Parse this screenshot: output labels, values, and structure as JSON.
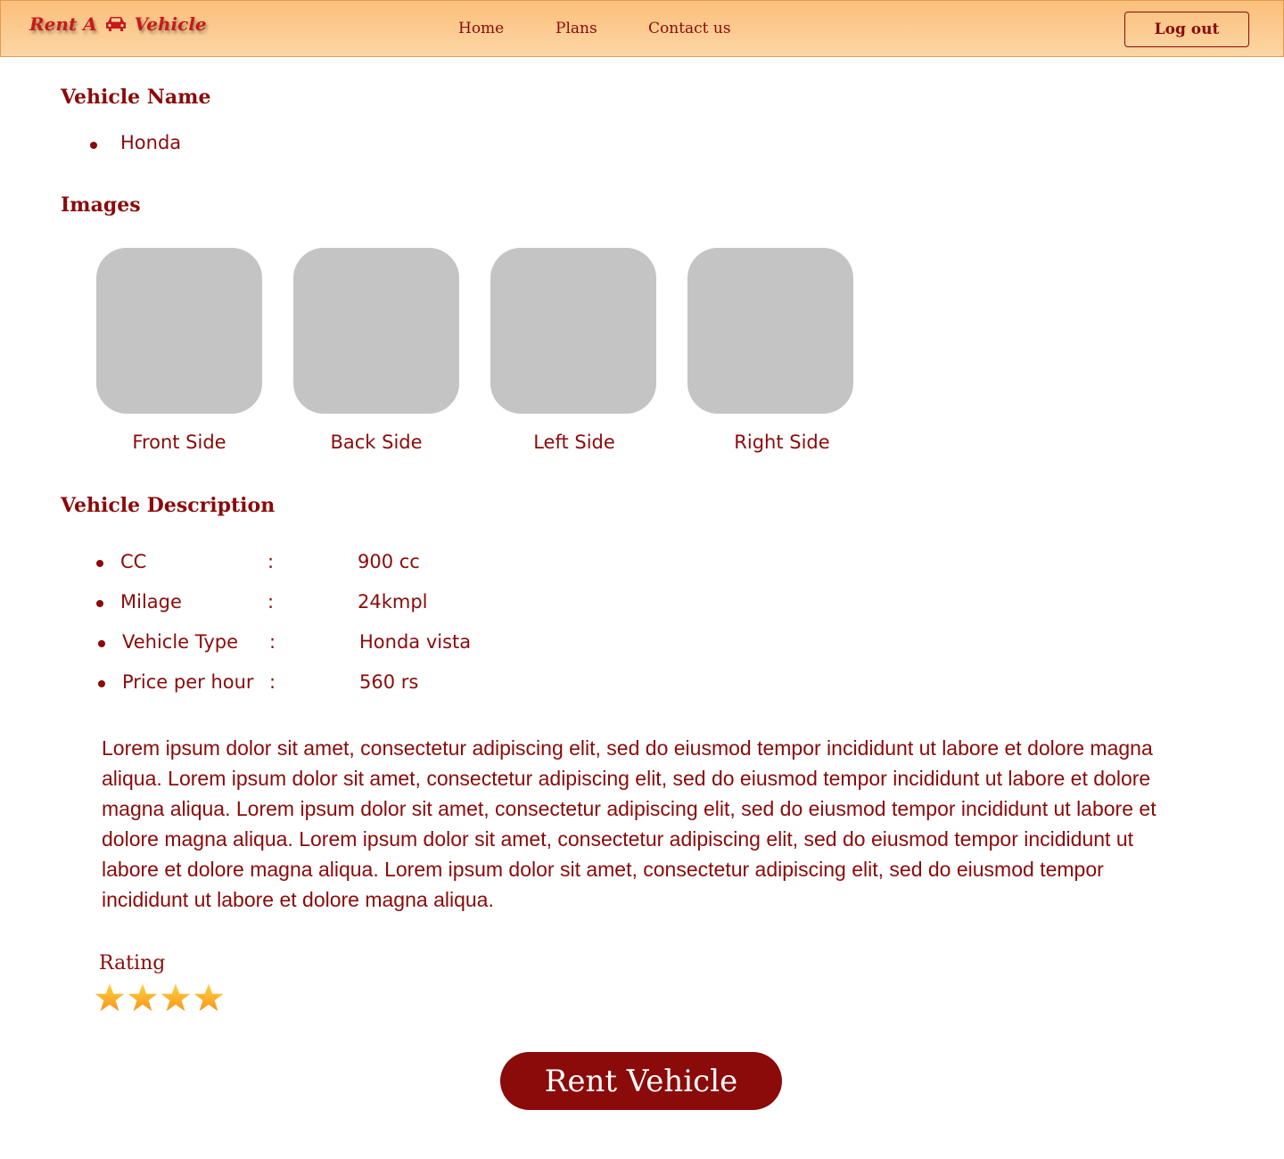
{
  "header": {
    "logo_prefix": "Rent A",
    "logo_suffix": "Vehicle",
    "nav": [
      "Home",
      "Plans",
      "Contact us"
    ],
    "logout_label": "Log out"
  },
  "vehicle_name": {
    "heading": "Vehicle Name",
    "value": "Honda"
  },
  "images": {
    "heading": "Images",
    "captions": [
      "Front Side",
      "Back Side",
      "Left Side",
      "Right Side"
    ]
  },
  "description": {
    "heading": "Vehicle Description",
    "specs": [
      {
        "label": "CC",
        "sep": ":",
        "value": "900 cc"
      },
      {
        "label": "Milage",
        "sep": ":",
        "value": "24kmpl"
      },
      {
        "label": "Vehicle Type",
        "sep": ":",
        "value": "Honda vista"
      },
      {
        "label": "Price per hour",
        "sep": ":",
        "value": "560 rs"
      }
    ],
    "paragraph": "Lorem ipsum dolor sit amet, consectetur adipiscing elit, sed do eiusmod tempor incididunt ut labore et dolore magna aliqua. Lorem ipsum dolor sit amet, consectetur adipiscing elit, sed do eiusmod tempor incididunt ut labore et dolore magna aliqua. Lorem ipsum dolor sit amet, consectetur adipiscing elit, sed do eiusmod tempor incididunt ut labore et dolore magna aliqua. Lorem ipsum dolor sit amet, consectetur adipiscing elit, sed do eiusmod tempor incididunt ut labore et dolore magna aliqua. Lorem ipsum dolor sit amet, consectetur adipiscing elit, sed do eiusmod tempor incididunt ut labore et dolore magna aliqua."
  },
  "rating": {
    "label": "Rating",
    "stars": 4
  },
  "rent_button_label": "Rent Vehicle",
  "colors": {
    "accent": "#8b0a0a",
    "header_top": "#fbbf7b",
    "header_bottom": "#fcd6a5",
    "placeholder": "#c4c4c4",
    "logo": "#c8191b"
  },
  "icons": {
    "logo": "car-icon",
    "rating": "star-icon"
  }
}
